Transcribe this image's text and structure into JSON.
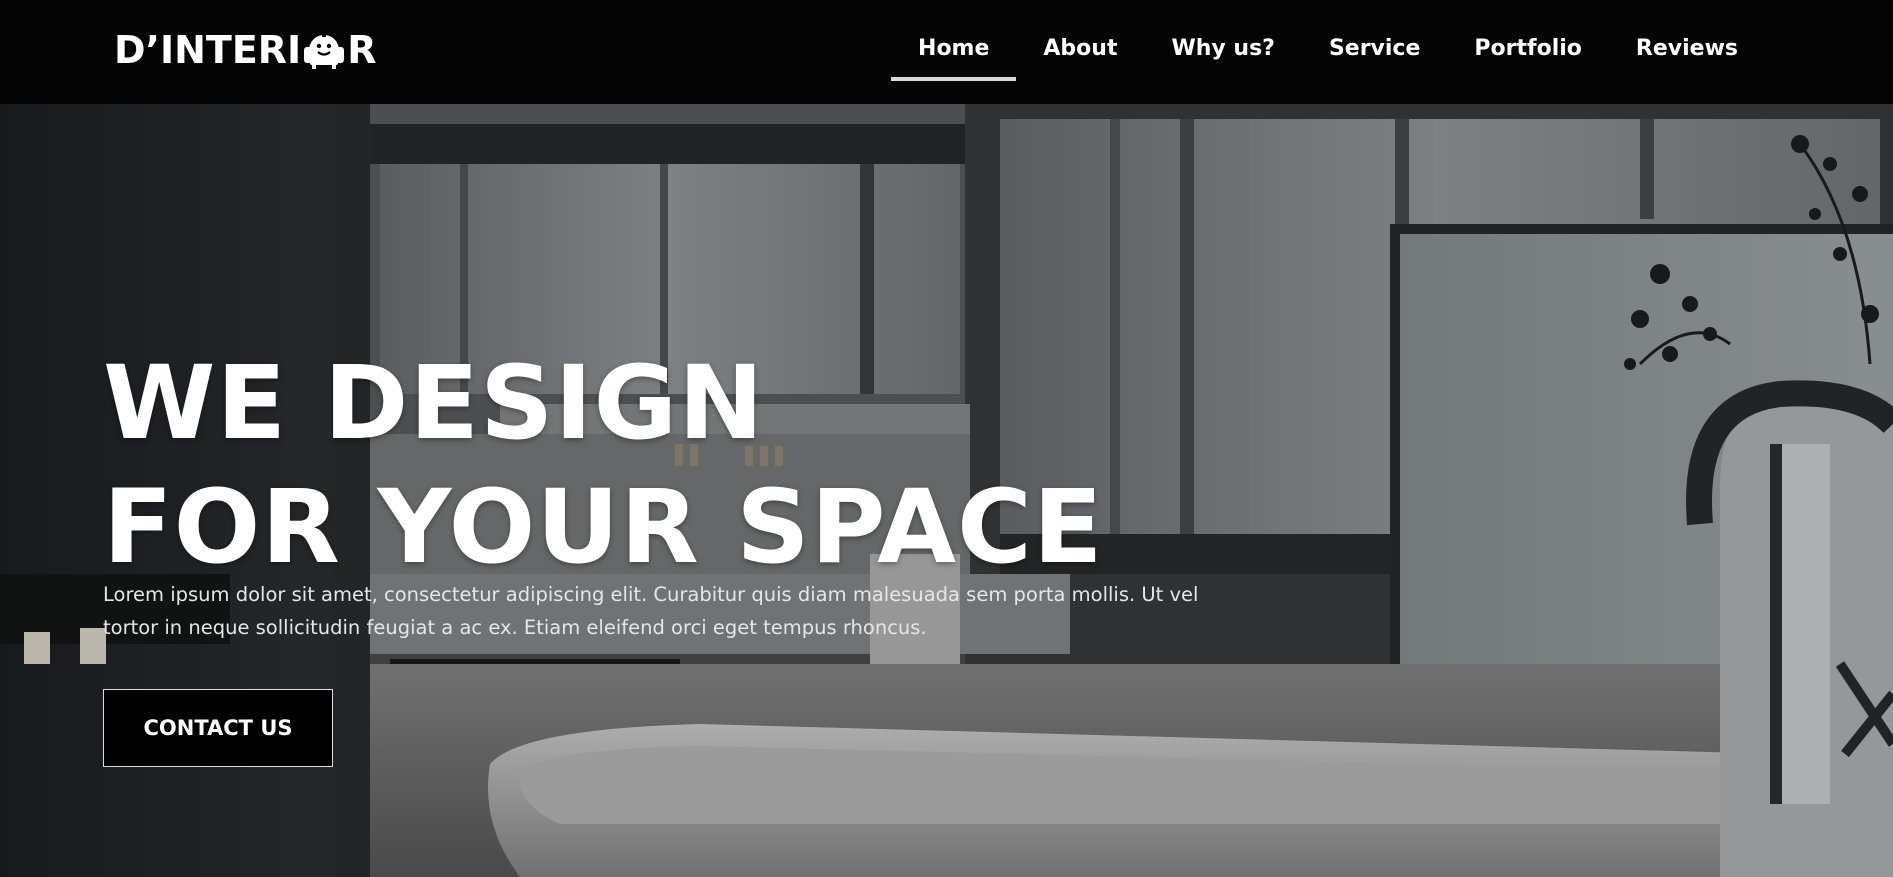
{
  "brand": {
    "logo_left": "D’INTERI",
    "logo_right": "R",
    "logo_icon": "sofa-face-icon"
  },
  "nav": {
    "items": [
      {
        "label": "Home",
        "active": true
      },
      {
        "label": "About"
      },
      {
        "label": "Why us?"
      },
      {
        "label": "Service"
      },
      {
        "label": "Portfolio"
      },
      {
        "label": "Reviews"
      }
    ]
  },
  "hero": {
    "headline_line1": "WE DESIGN",
    "headline_line2": "FOR YOUR SPACE",
    "description": "Lorem ipsum dolor sit amet, consectetur adipiscing elit. Curabitur quis diam malesuada sem porta mollis. Ut vel tortor in neque sollicitudin feugiat a ac ex. Etiam eleifend orci eget tempus rhoncus.",
    "cta_label": "CONTACT US"
  },
  "colors": {
    "navbar": "#050505",
    "active_underline": "#d9d9d9",
    "cta_bg": "#000000"
  }
}
